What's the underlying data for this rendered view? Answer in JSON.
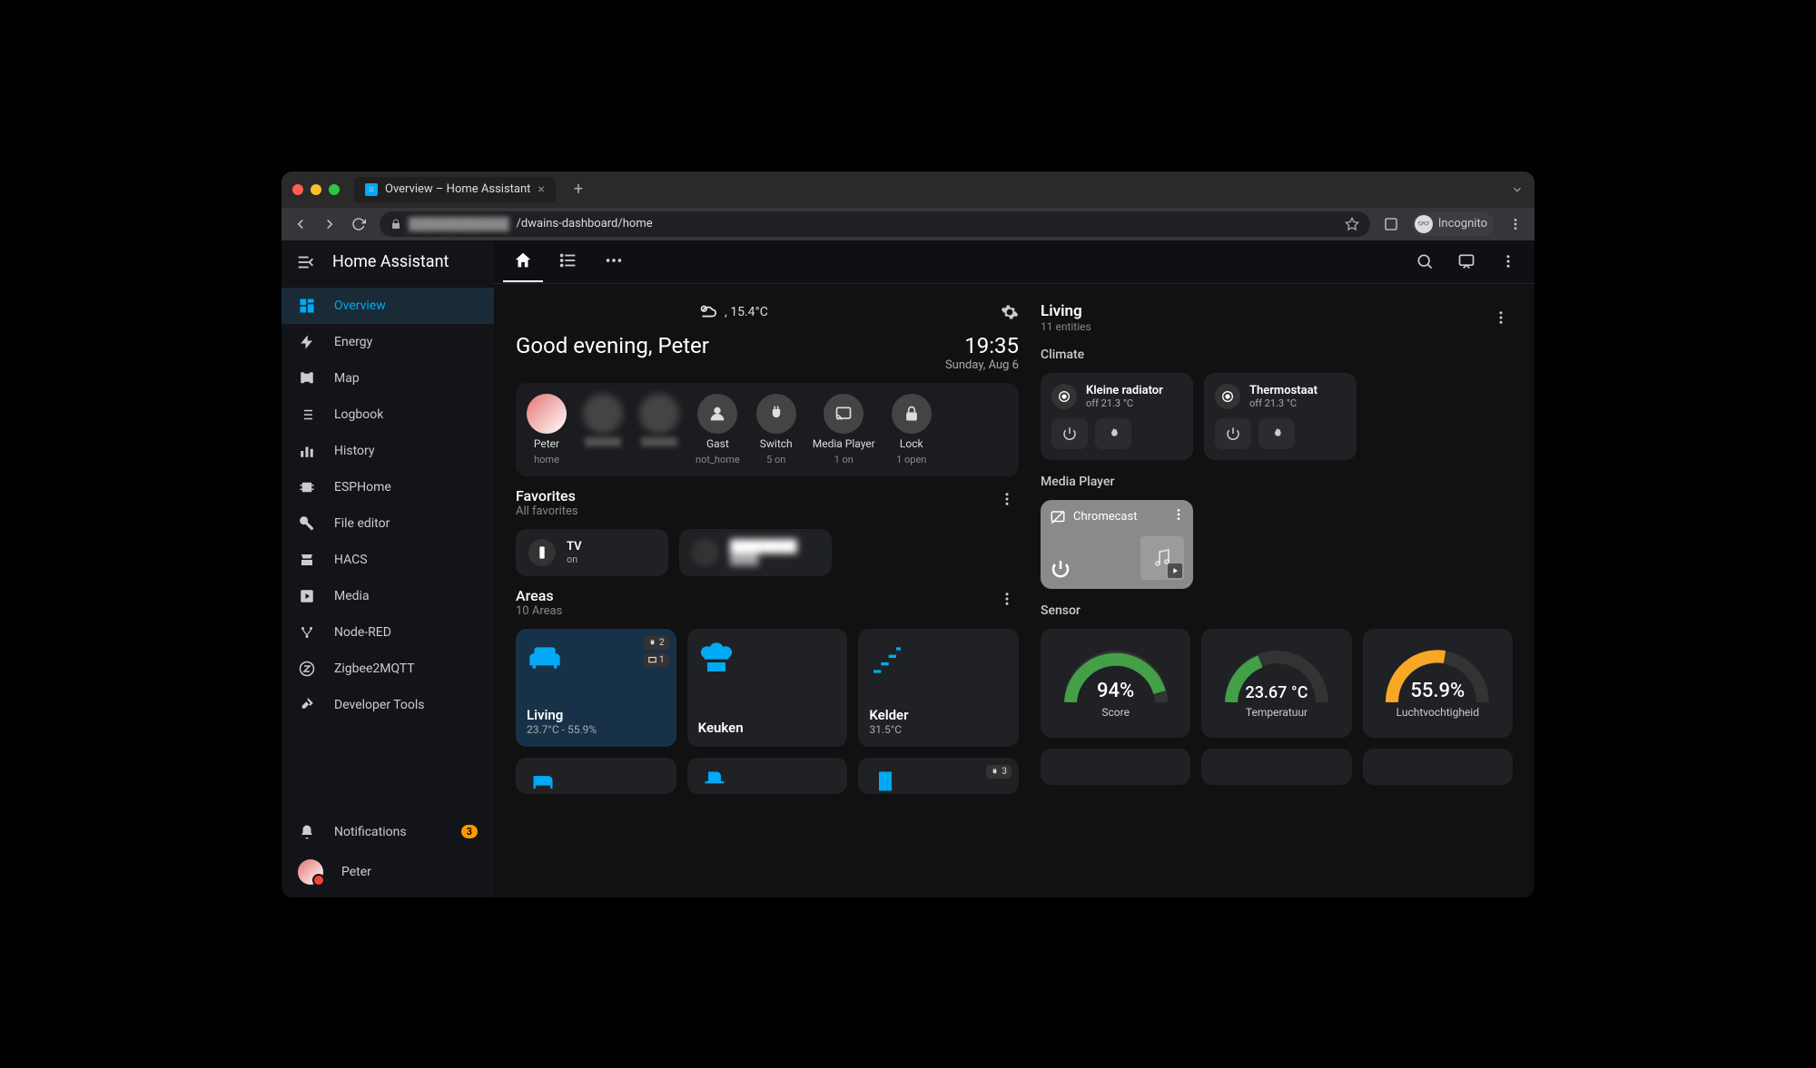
{
  "browser": {
    "tab_title": "Overview – Home Assistant",
    "url_host": "████████████",
    "url_path": "/dwains-dashboard/home",
    "mode": "Incognito"
  },
  "sidebar": {
    "app_title": "Home Assistant",
    "items": [
      {
        "label": "Overview"
      },
      {
        "label": "Energy"
      },
      {
        "label": "Map"
      },
      {
        "label": "Logbook"
      },
      {
        "label": "History"
      },
      {
        "label": "ESPHome"
      },
      {
        "label": "File editor"
      },
      {
        "label": "HACS"
      },
      {
        "label": "Media"
      },
      {
        "label": "Node-RED"
      },
      {
        "label": "Zigbee2MQTT"
      },
      {
        "label": "Developer Tools"
      }
    ],
    "notifications": {
      "label": "Notifications",
      "count": "3"
    },
    "user": "Peter"
  },
  "header": {
    "weather_temp": ", 15.4°C",
    "greeting": "Good evening, Peter",
    "time": "19:35",
    "date": "Sunday, Aug 6"
  },
  "chips": [
    {
      "label": "Peter",
      "sub": "home"
    },
    {
      "label": "",
      "sub": ""
    },
    {
      "label": "",
      "sub": ""
    },
    {
      "label": "Gast",
      "sub": "not_home"
    },
    {
      "label": "Switch",
      "sub": "5 on"
    },
    {
      "label": "Media Player",
      "sub": "1 on"
    },
    {
      "label": "Lock",
      "sub": "1 open"
    }
  ],
  "favorites": {
    "title": "Favorites",
    "sub": "All favorites",
    "items": [
      {
        "label": "TV",
        "state": "on"
      },
      {
        "label": "████████",
        "state": "████"
      }
    ]
  },
  "areas": {
    "title": "Areas",
    "sub": "10 Areas",
    "items": [
      {
        "name": "Living",
        "sub": "23.7°C - 55.9%",
        "badges": [
          "2",
          "1"
        ]
      },
      {
        "name": "Keuken",
        "sub": ""
      },
      {
        "name": "Kelder",
        "sub": "31.5°C"
      },
      {
        "name": "",
        "sub": ""
      },
      {
        "name": "",
        "sub": ""
      },
      {
        "name": "",
        "sub": "",
        "badges": [
          "3"
        ]
      }
    ]
  },
  "right": {
    "title": "Living",
    "sub": "11 entities",
    "climate_label": "Climate",
    "climate": [
      {
        "title": "Kleine radiator",
        "state": "off 21.3 °C"
      },
      {
        "title": "Thermostaat",
        "state": "off 21.3 °C"
      }
    ],
    "mp_label": "Media Player",
    "mp_name": "Chromecast",
    "sensor_label": "Sensor",
    "sensors": [
      {
        "value": "94%",
        "label": "Score",
        "pct": 94,
        "color": "#43a047"
      },
      {
        "value": "23.67 °C",
        "label": "Temperatuur",
        "pct": 40,
        "color": "#43a047"
      },
      {
        "value": "55.9%",
        "label": "Luchtvochtigheid",
        "pct": 56,
        "color": "#f9a825"
      }
    ]
  }
}
